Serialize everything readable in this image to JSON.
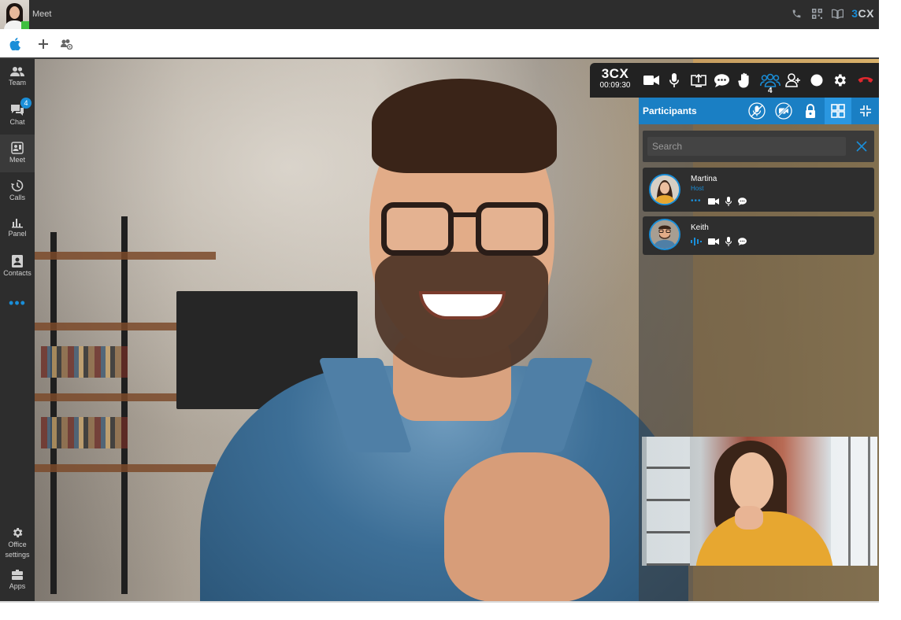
{
  "window": {
    "title": "Meet"
  },
  "header": {
    "icons": [
      "phone-icon",
      "qr-code-icon",
      "book-icon"
    ],
    "brand": {
      "part1": "3",
      "part2": "CX"
    }
  },
  "toolbar": {
    "icons": [
      "apple-icon",
      "plus-icon",
      "group-settings-icon"
    ]
  },
  "sidebar": {
    "items": [
      {
        "label": "Team",
        "icon": "team-icon"
      },
      {
        "label": "Chat",
        "icon": "chat-icon",
        "badge": "4"
      },
      {
        "label": "Meet",
        "icon": "meet-icon",
        "active": true
      },
      {
        "label": "Calls",
        "icon": "history-icon"
      },
      {
        "label": "Panel",
        "icon": "bar-chart-icon"
      },
      {
        "label": "Contacts",
        "icon": "contact-card-icon"
      }
    ],
    "more": "•••",
    "office_settings": {
      "label1": "Office",
      "label2": "settings"
    },
    "apps": {
      "label": "Apps"
    }
  },
  "controls": {
    "timer": "00:09:30",
    "participant_count": "4",
    "buttons": [
      "camera-icon",
      "microphone-icon",
      "share-screen-icon",
      "chat-bubble-icon",
      "raise-hand-icon",
      "participants-icon",
      "add-user-icon",
      "record-icon",
      "settings-icon",
      "hang-up-icon"
    ]
  },
  "participants_panel": {
    "title": "Participants",
    "header_buttons": [
      "mute-all-icon",
      "camera-off-icon",
      "lock-icon",
      "grid-view-icon",
      "collapse-icon"
    ],
    "search": {
      "placeholder": "Search",
      "value": ""
    },
    "list": [
      {
        "name": "Martina",
        "role": "Host"
      },
      {
        "name": "Keith",
        "role": ""
      }
    ]
  },
  "colors": {
    "accent": "#1a8ed8",
    "panel_header": "#1a7fc4",
    "hangup": "#e0282e",
    "status_online": "#3fbf3f"
  }
}
